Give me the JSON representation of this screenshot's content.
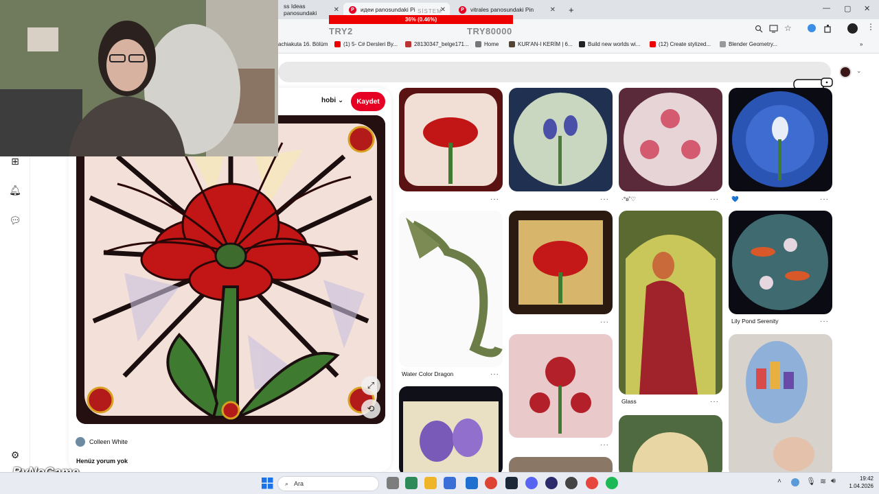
{
  "browser": {
    "tabs": [
      {
        "label": "ss Ideas panosundaki",
        "active": false
      },
      {
        "label": "идеи panosundaki Pi",
        "active": true
      },
      {
        "label": "vitrales panosundaki Pin",
        "active": false
      }
    ],
    "new_tab": "+",
    "window_controls": [
      "—",
      "▢",
      "✕"
    ],
    "bookmarks": [
      "achiakuta 16. Bölüm",
      "(1) 5- C# Dersleri By...",
      "28130347_belge171...",
      "Home",
      "KUR'AN-I KERİM | 6...",
      "Build new worlds wi...",
      "(12) Create stylized...",
      "Blender Geometry..."
    ]
  },
  "overlay": {
    "bar_text": "36% (0.46%)",
    "bar_label": "SİSTEM",
    "left_value": "TRY2",
    "right_value": "TRY80000"
  },
  "pin": {
    "board": "hobi",
    "save_label": "Kaydet",
    "author": "Colleen White",
    "comments": "Henüz yorum yok"
  },
  "grid": {
    "captions": {
      "c3": "·°ʚ˚♡",
      "c4": "💙",
      "lily": "Lily Pond Serenity",
      "dragon": "Water Color Dragon",
      "glass": "Glass"
    },
    "more": "···"
  },
  "streamer_logo": "ByNoGame",
  "taskbar": {
    "search_placeholder": "Ara",
    "time": "19:42",
    "date": "1.04.2026"
  },
  "colors": {
    "pinterest_red": "#e60023",
    "overlay_red": "#ee0000"
  }
}
